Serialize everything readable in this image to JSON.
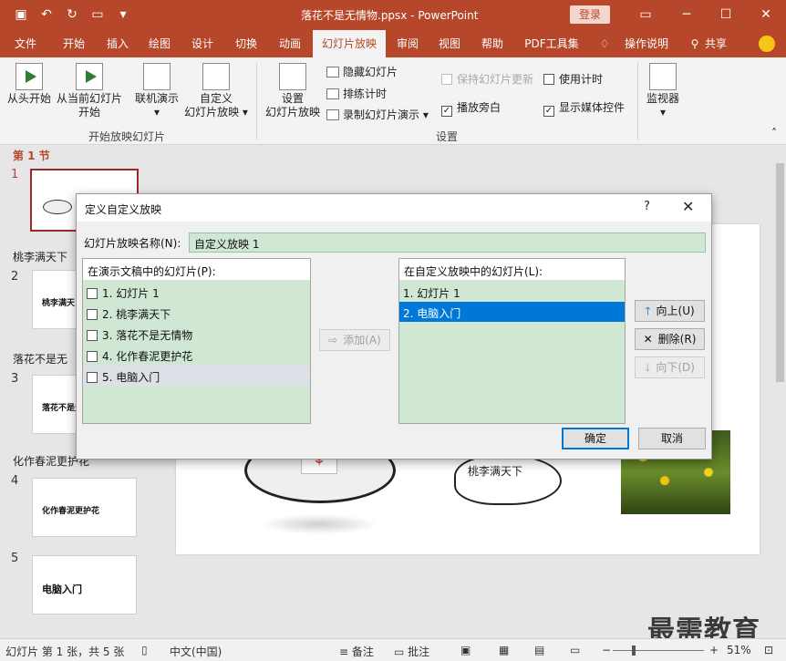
{
  "titlebar": {
    "doc_title": "落花不是无情物.ppsx - PowerPoint",
    "login": "登录",
    "qat_icons": [
      "save-icon",
      "undo-icon",
      "redo-icon",
      "present-icon",
      "customize-icon"
    ]
  },
  "tabs": [
    "文件",
    "开始",
    "插入",
    "绘图",
    "设计",
    "切换",
    "动画",
    "幻灯片放映",
    "审阅",
    "视图",
    "帮助",
    "PDF工具集",
    "操作说明",
    "共享"
  ],
  "active_tab": "幻灯片放映",
  "ribbon": {
    "from_start": "从头开始",
    "from_current_1": "从当前幻灯片",
    "from_current_2": "开始",
    "online_present_1": "联机演示",
    "online_present_2": "▾",
    "custom_show_1": "自定义",
    "custom_show_2": "幻灯片放映 ▾",
    "group_start": "开始放映幻灯片",
    "setup_1": "设置",
    "setup_2": "幻灯片放映",
    "hide_slide": "隐藏幻灯片",
    "rehearse": "排练计时",
    "record": "录制幻灯片演示 ▾",
    "keep_updated": "保持幻灯片更新",
    "use_timings": "使用计时",
    "play_narration": "播放旁白",
    "show_media": "显示媒体控件",
    "group_setup": "设置",
    "monitor_1": "监视器",
    "monitor_2": "▾"
  },
  "slides_panel": {
    "sections": [
      "第 1 节",
      "桃李满天下",
      "落花不是无",
      "化作春泥更护花"
    ],
    "slides": [
      {
        "num": "1",
        "text": ""
      },
      {
        "num": "2",
        "text": "桃李满天"
      },
      {
        "num": "3",
        "text": "落花不是无情物"
      },
      {
        "num": "4",
        "text": "化作春泥更护花"
      },
      {
        "num": "5",
        "text": "电脑入门"
      }
    ]
  },
  "slide_canvas": {
    "blob_label": "桃李满天下"
  },
  "dialog": {
    "title": "定义自定义放映",
    "help": "?",
    "close": "✕",
    "name_label": "幻灯片放映名称(N):",
    "name_value": "自定义放映 1",
    "left_header": "在演示文稿中的幻灯片(P):",
    "left_items": [
      "1. 幻灯片 1",
      "2. 桃李满天下",
      "3. 落花不是无情物",
      "4. 化作春泥更护花",
      "5. 电脑入门"
    ],
    "add_button": "添加(A)",
    "right_header": "在自定义放映中的幻灯片(L):",
    "right_items": [
      "1. 幻灯片 1",
      "2. 电脑入门"
    ],
    "up_button": "向上(U)",
    "delete_button": "删除(R)",
    "down_button": "向下(D)",
    "ok_button": "确定",
    "cancel_button": "取消"
  },
  "statusbar": {
    "slide_info": "幻灯片 第 1 张，共 5 张",
    "language": "中文(中国)",
    "notes": "备注",
    "comments": "批注",
    "zoom": "51%"
  },
  "watermark": "最需教育",
  "colors": {
    "accent": "#b7472a",
    "selection": "#0078d7",
    "list_bg": "#cfe7d3"
  }
}
